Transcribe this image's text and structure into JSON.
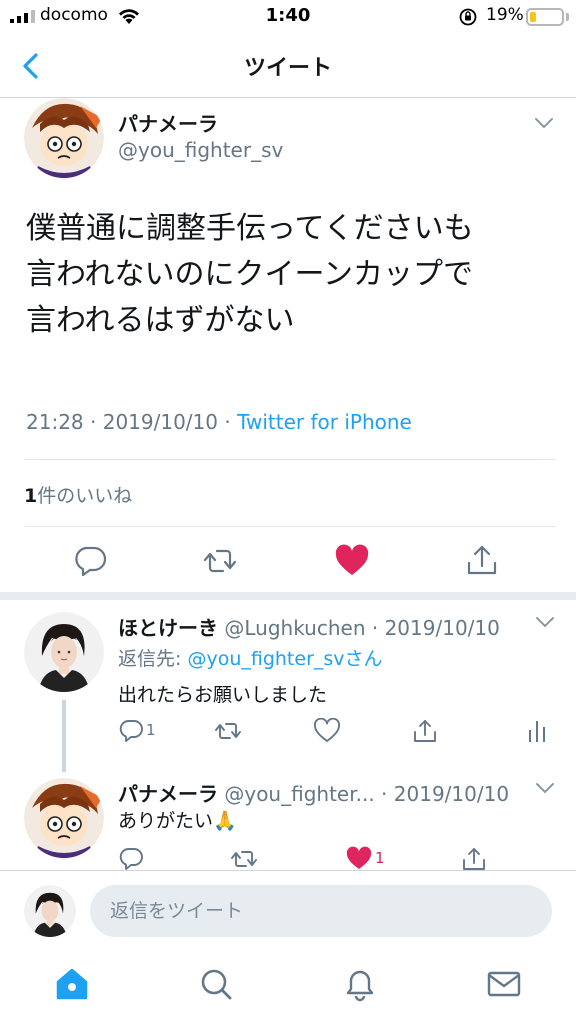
{
  "status": {
    "carrier": "docomo",
    "time": "1:40",
    "battery_percent": "19%",
    "battery_level": 0.19,
    "battery_color": "#f5c518"
  },
  "nav": {
    "back_icon": "chevron-left-icon",
    "title": "ツイート"
  },
  "tweet": {
    "author_name": "パナメーラ",
    "author_handle": "@you_fighter_sv",
    "text_lines": [
      "僕普通に調整手伝ってくださいも",
      "言われないのにクイーンカップで",
      "言われるはずがない"
    ],
    "time": "21:28",
    "date": "2019/10/10",
    "source": "Twitter for iPhone",
    "likes_count": "1",
    "likes_label": "件のいいね",
    "liked": true,
    "like_color": "#e0245e",
    "accent": "#1da1f2"
  },
  "replies": [
    {
      "name": "ほとけーき",
      "handle": "@Lughkuchen",
      "date": "2019/10/10",
      "reply_to_label": "返信先:",
      "reply_to_handle": "@you_fighter_sv",
      "reply_to_suffix": "さん",
      "text": "出れたらお願いしました",
      "reply_count": "1"
    },
    {
      "name": "パナメーラ",
      "handle": "@you_fighter...",
      "date": "2019/10/10",
      "text": "ありがたい🙏",
      "like_count": "1"
    }
  ],
  "compose": {
    "placeholder": "返信をツイート"
  },
  "tabs": [
    "home-icon",
    "search-icon",
    "notifications-icon",
    "messages-icon"
  ]
}
